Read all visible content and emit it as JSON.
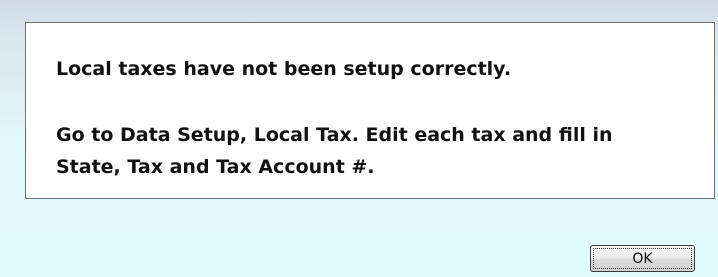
{
  "message": {
    "line1": "Local taxes have not been setup correctly.",
    "line2": "Go to Data Setup, Local Tax. Edit each tax and fill in",
    "line3": "State, Tax and Tax Account #."
  },
  "buttons": {
    "ok_label": "OK"
  },
  "colors": {
    "background_top": "#d2dbe6",
    "background_bottom": "#e0fcff",
    "message_box_bg": "#ffffff",
    "message_border": "#6f6f6f",
    "text": "#111111"
  }
}
